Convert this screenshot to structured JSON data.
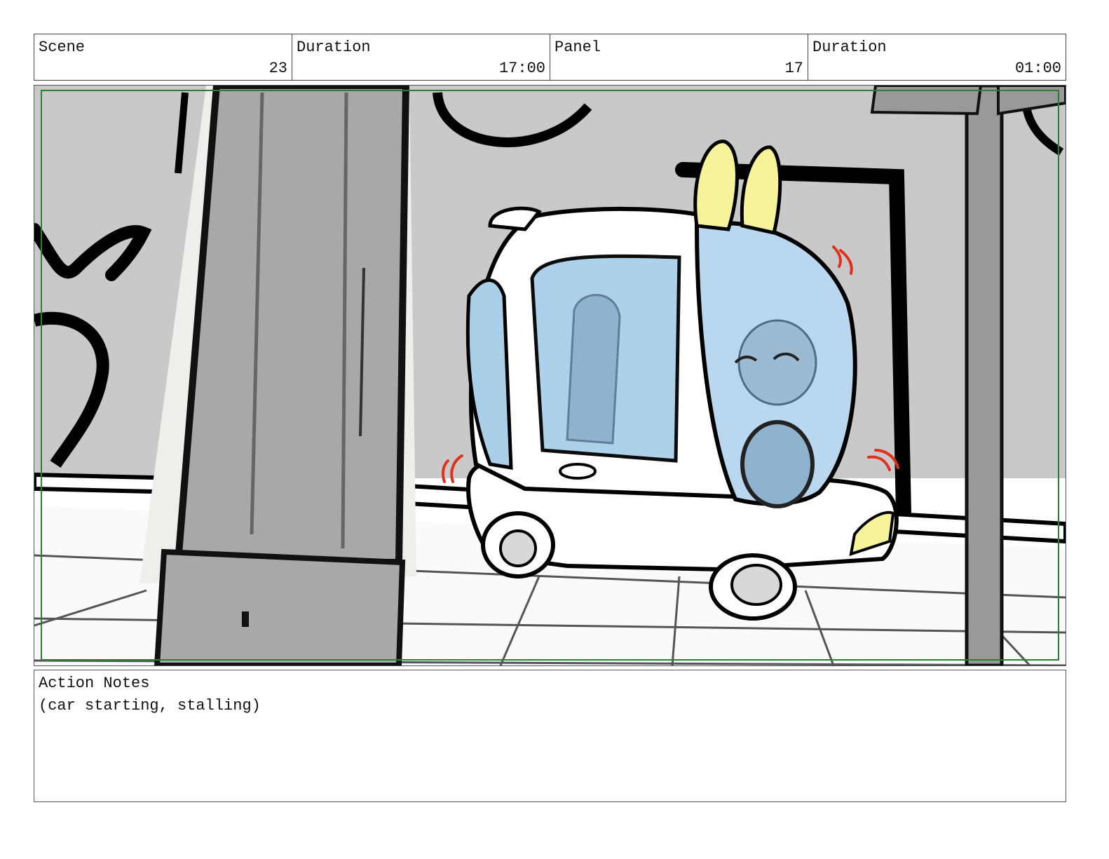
{
  "header": {
    "scene_label": "Scene",
    "scene_value": "23",
    "scene_duration_label": "Duration",
    "scene_duration_value": "17:00",
    "panel_label": "Panel",
    "panel_value": "17",
    "panel_duration_label": "Duration",
    "panel_duration_value": "01:00"
  },
  "notes": {
    "label": "Action Notes",
    "text": "(car starting, stalling)"
  },
  "colors": {
    "frame_guide": "#2e7d32",
    "wall": "#c8c8c8",
    "car_glass": "#a9cfe9",
    "ears": "#f6f39a",
    "shake_marks": "#e0301e"
  }
}
